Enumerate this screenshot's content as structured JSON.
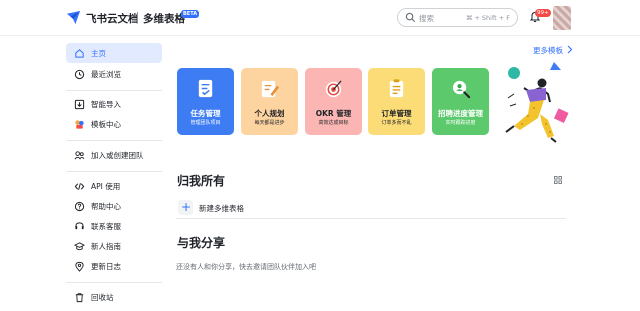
{
  "header": {
    "brand": "飞书云文档",
    "product": "多维表格",
    "beta_label": "BETA",
    "search_placeholder": "搜索",
    "search_shortcut": "⌘ + Shift + F",
    "notification_count": "99+"
  },
  "sidebar": {
    "items": [
      {
        "label": "主页",
        "icon": "home-icon",
        "active": true
      },
      {
        "label": "最近浏览",
        "icon": "clock-icon"
      },
      {
        "label": "智能导入",
        "icon": "import-icon"
      },
      {
        "label": "模板中心",
        "icon": "template-icon"
      },
      {
        "label": "加入或创建团队",
        "icon": "team-icon"
      },
      {
        "label": "API 使用",
        "icon": "code-icon"
      },
      {
        "label": "帮助中心",
        "icon": "help-icon"
      },
      {
        "label": "联系客服",
        "icon": "service-icon"
      },
      {
        "label": "新人指南",
        "icon": "guide-icon"
      },
      {
        "label": "更新日志",
        "icon": "location-icon"
      },
      {
        "label": "回收站",
        "icon": "trash-icon"
      }
    ]
  },
  "templates": {
    "more_label": "更多模板",
    "cards": [
      {
        "title": "任务管理",
        "subtitle": "管理团队项目",
        "bg": "#3d7cf2",
        "fg": "#ffffff"
      },
      {
        "title": "个人规划",
        "subtitle": "每天都是进步",
        "bg": "#fdd3a0",
        "fg": "#1f2329"
      },
      {
        "title": "OKR 管理",
        "subtitle": "高效达成目标",
        "bg": "#fbb6b3",
        "fg": "#1f2329"
      },
      {
        "title": "订单管理",
        "subtitle": "订单多而不乱",
        "bg": "#fcdc76",
        "fg": "#1f2329"
      },
      {
        "title": "招聘进度管理",
        "subtitle": "实时跟踪进度",
        "bg": "#5cc96c",
        "fg": "#ffffff"
      }
    ]
  },
  "mine": {
    "title": "归我所有",
    "new_label": "新建多维表格"
  },
  "shared": {
    "title": "与我分享",
    "empty_text": "还没有人和你分享，快去邀请团队伙伴加入吧"
  }
}
